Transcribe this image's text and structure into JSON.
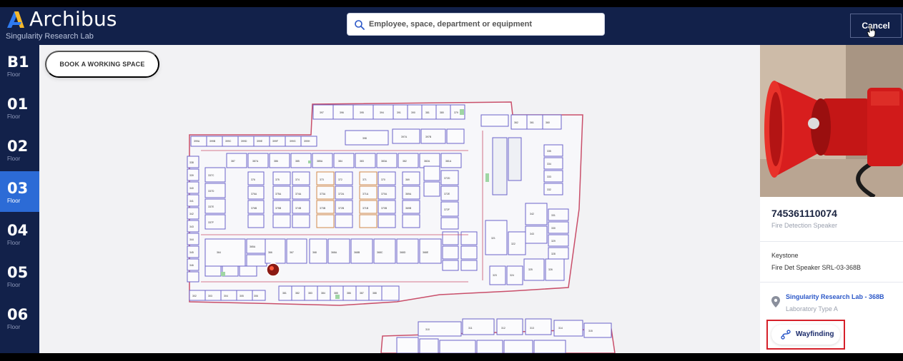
{
  "app": {
    "name": "Archibus",
    "subtitle": "Singularity Research Lab"
  },
  "search": {
    "placeholder": "Employee, space, department or equipment"
  },
  "header": {
    "cancel_label": "Cancel"
  },
  "floors": [
    {
      "num": "B1",
      "label": "Floor",
      "active": false
    },
    {
      "num": "01",
      "label": "Floor",
      "active": false
    },
    {
      "num": "02",
      "label": "Floor",
      "active": false
    },
    {
      "num": "03",
      "label": "Floor",
      "active": true
    },
    {
      "num": "04",
      "label": "Floor",
      "active": false
    },
    {
      "num": "05",
      "label": "Floor",
      "active": false
    },
    {
      "num": "06",
      "label": "Floor",
      "active": false
    }
  ],
  "map": {
    "book_label": "BOOK A WORKING SPACE"
  },
  "asset": {
    "id": "745361110074",
    "type": "Fire Detection Speaker",
    "brand": "Keystone",
    "name": "Fire Det Speaker SRL-03-368B",
    "location_name": "Singularity Research Lab - 368B",
    "location_type": "Laboratory Type A",
    "wayfinding_label": "Wayfinding"
  },
  "colors": {
    "nav_bg": "#12214a",
    "active_floor": "#2c6bd6",
    "link": "#2c58c8",
    "highlight": "#d6202a",
    "room_outline": "#6b63c9",
    "wall": "#c94f6a"
  }
}
